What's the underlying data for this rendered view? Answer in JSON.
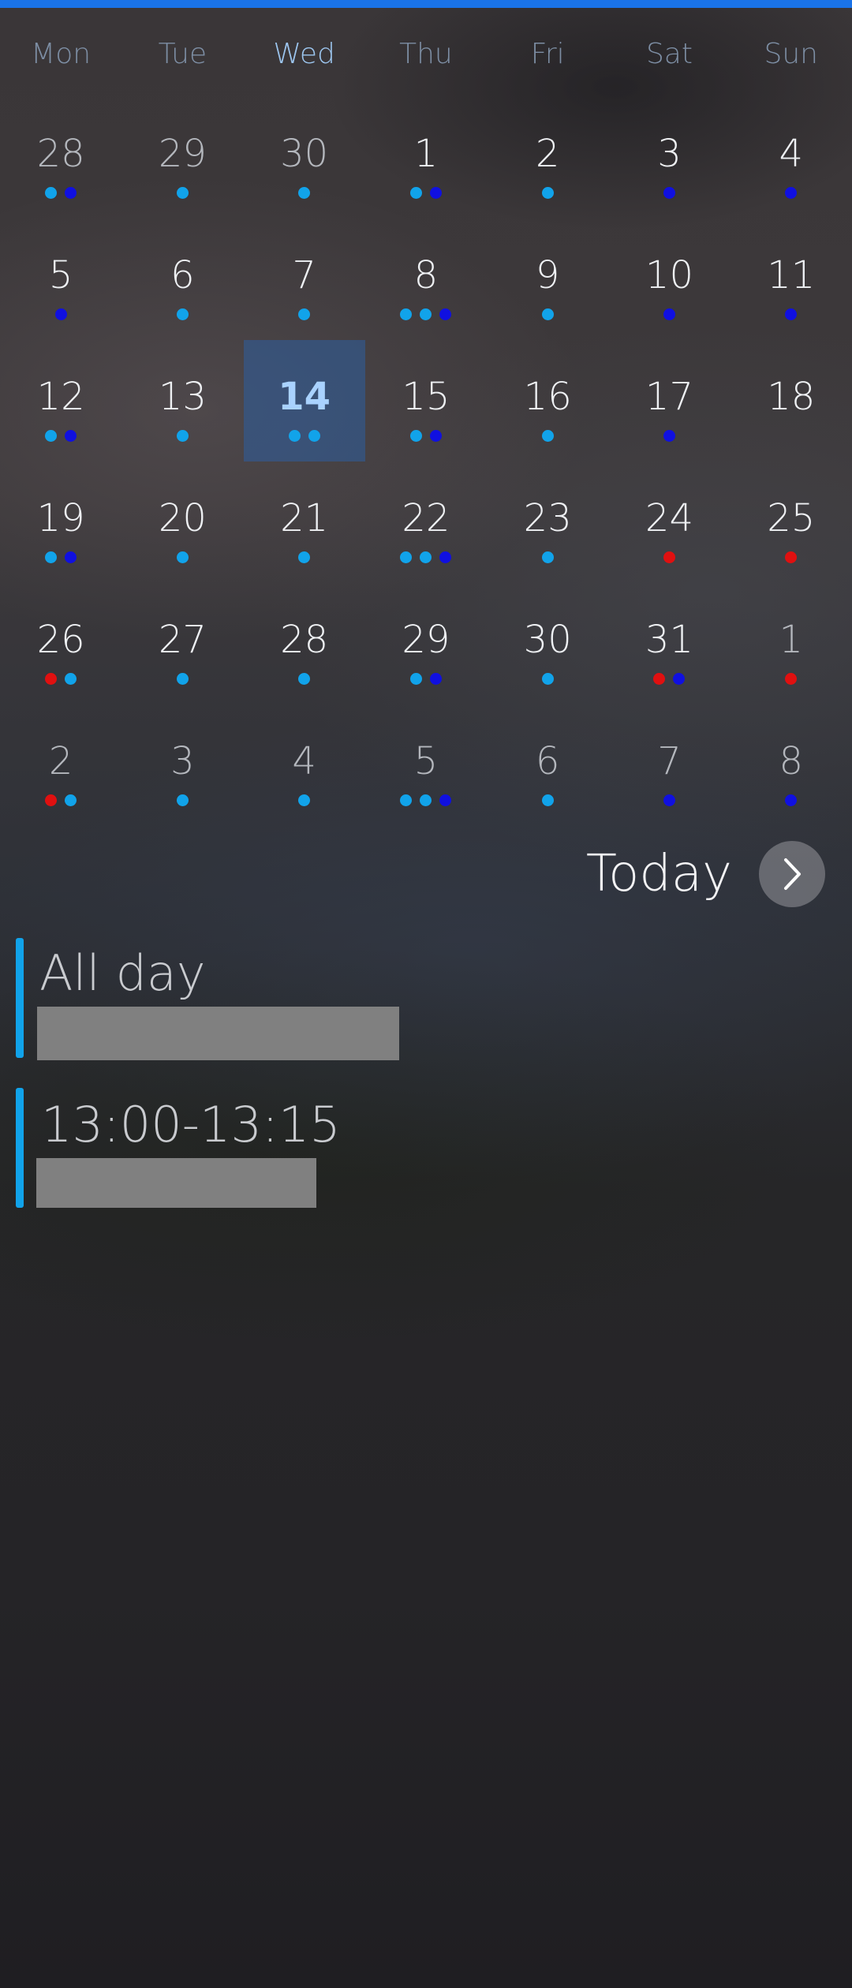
{
  "colors": {
    "top_bar": "#1a73e8",
    "dot_light_blue": "#11a3ea",
    "dot_dark_blue": "#1010e0",
    "dot_red": "#e01010",
    "event_bar": "#11a3ea"
  },
  "weekdays": [
    "Mon",
    "Tue",
    "Wed",
    "Thu",
    "Fri",
    "Sat",
    "Sun"
  ],
  "calendar": {
    "selected_day": "14",
    "weeks": [
      [
        {
          "label": "28",
          "other": true,
          "dots": [
            "lb",
            "db"
          ]
        },
        {
          "label": "29",
          "other": true,
          "dots": [
            "lb"
          ]
        },
        {
          "label": "30",
          "other": true,
          "dots": [
            "lb"
          ]
        },
        {
          "label": "1",
          "other": false,
          "dots": [
            "lb",
            "db"
          ]
        },
        {
          "label": "2",
          "other": false,
          "dots": [
            "lb"
          ]
        },
        {
          "label": "3",
          "other": false,
          "dots": [
            "db"
          ]
        },
        {
          "label": "4",
          "other": false,
          "dots": [
            "db"
          ]
        }
      ],
      [
        {
          "label": "5",
          "other": false,
          "dots": [
            "db"
          ]
        },
        {
          "label": "6",
          "other": false,
          "dots": [
            "lb"
          ]
        },
        {
          "label": "7",
          "other": false,
          "dots": [
            "lb"
          ]
        },
        {
          "label": "8",
          "other": false,
          "dots": [
            "lb",
            "lb",
            "db"
          ]
        },
        {
          "label": "9",
          "other": false,
          "dots": [
            "lb"
          ]
        },
        {
          "label": "10",
          "other": false,
          "dots": [
            "db"
          ]
        },
        {
          "label": "11",
          "other": false,
          "dots": [
            "db"
          ]
        }
      ],
      [
        {
          "label": "12",
          "other": false,
          "dots": [
            "lb",
            "db"
          ]
        },
        {
          "label": "13",
          "other": false,
          "dots": [
            "lb"
          ]
        },
        {
          "label": "14",
          "other": false,
          "selected": true,
          "dots": [
            "lb",
            "lb"
          ]
        },
        {
          "label": "15",
          "other": false,
          "dots": [
            "lb",
            "db"
          ]
        },
        {
          "label": "16",
          "other": false,
          "dots": [
            "lb"
          ]
        },
        {
          "label": "17",
          "other": false,
          "dots": [
            "db"
          ]
        },
        {
          "label": "18",
          "other": false,
          "dots": []
        }
      ],
      [
        {
          "label": "19",
          "other": false,
          "dots": [
            "lb",
            "db"
          ]
        },
        {
          "label": "20",
          "other": false,
          "dots": [
            "lb"
          ]
        },
        {
          "label": "21",
          "other": false,
          "dots": [
            "lb"
          ]
        },
        {
          "label": "22",
          "other": false,
          "dots": [
            "lb",
            "lb",
            "db"
          ]
        },
        {
          "label": "23",
          "other": false,
          "dots": [
            "lb"
          ]
        },
        {
          "label": "24",
          "other": false,
          "dots": [
            "red"
          ]
        },
        {
          "label": "25",
          "other": false,
          "dots": [
            "red"
          ]
        }
      ],
      [
        {
          "label": "26",
          "other": false,
          "dots": [
            "red",
            "lb"
          ]
        },
        {
          "label": "27",
          "other": false,
          "dots": [
            "lb"
          ]
        },
        {
          "label": "28",
          "other": false,
          "dots": [
            "lb"
          ]
        },
        {
          "label": "29",
          "other": false,
          "dots": [
            "lb",
            "db"
          ]
        },
        {
          "label": "30",
          "other": false,
          "dots": [
            "lb"
          ]
        },
        {
          "label": "31",
          "other": false,
          "dots": [
            "red",
            "db"
          ]
        },
        {
          "label": "1",
          "other": true,
          "dots": [
            "red"
          ]
        }
      ],
      [
        {
          "label": "2",
          "other": true,
          "dots": [
            "red",
            "lb"
          ]
        },
        {
          "label": "3",
          "other": true,
          "dots": [
            "lb"
          ]
        },
        {
          "label": "4",
          "other": true,
          "dots": [
            "lb"
          ]
        },
        {
          "label": "5",
          "other": true,
          "dots": [
            "lb",
            "lb",
            "db"
          ]
        },
        {
          "label": "6",
          "other": true,
          "dots": [
            "lb"
          ]
        },
        {
          "label": "7",
          "other": true,
          "dots": [
            "db"
          ]
        },
        {
          "label": "8",
          "other": true,
          "dots": [
            "db"
          ]
        }
      ]
    ]
  },
  "today": {
    "label": "Today",
    "icon": "chevron-right-icon"
  },
  "events": [
    {
      "time": "All day"
    },
    {
      "time": "13:00-13:15"
    }
  ]
}
